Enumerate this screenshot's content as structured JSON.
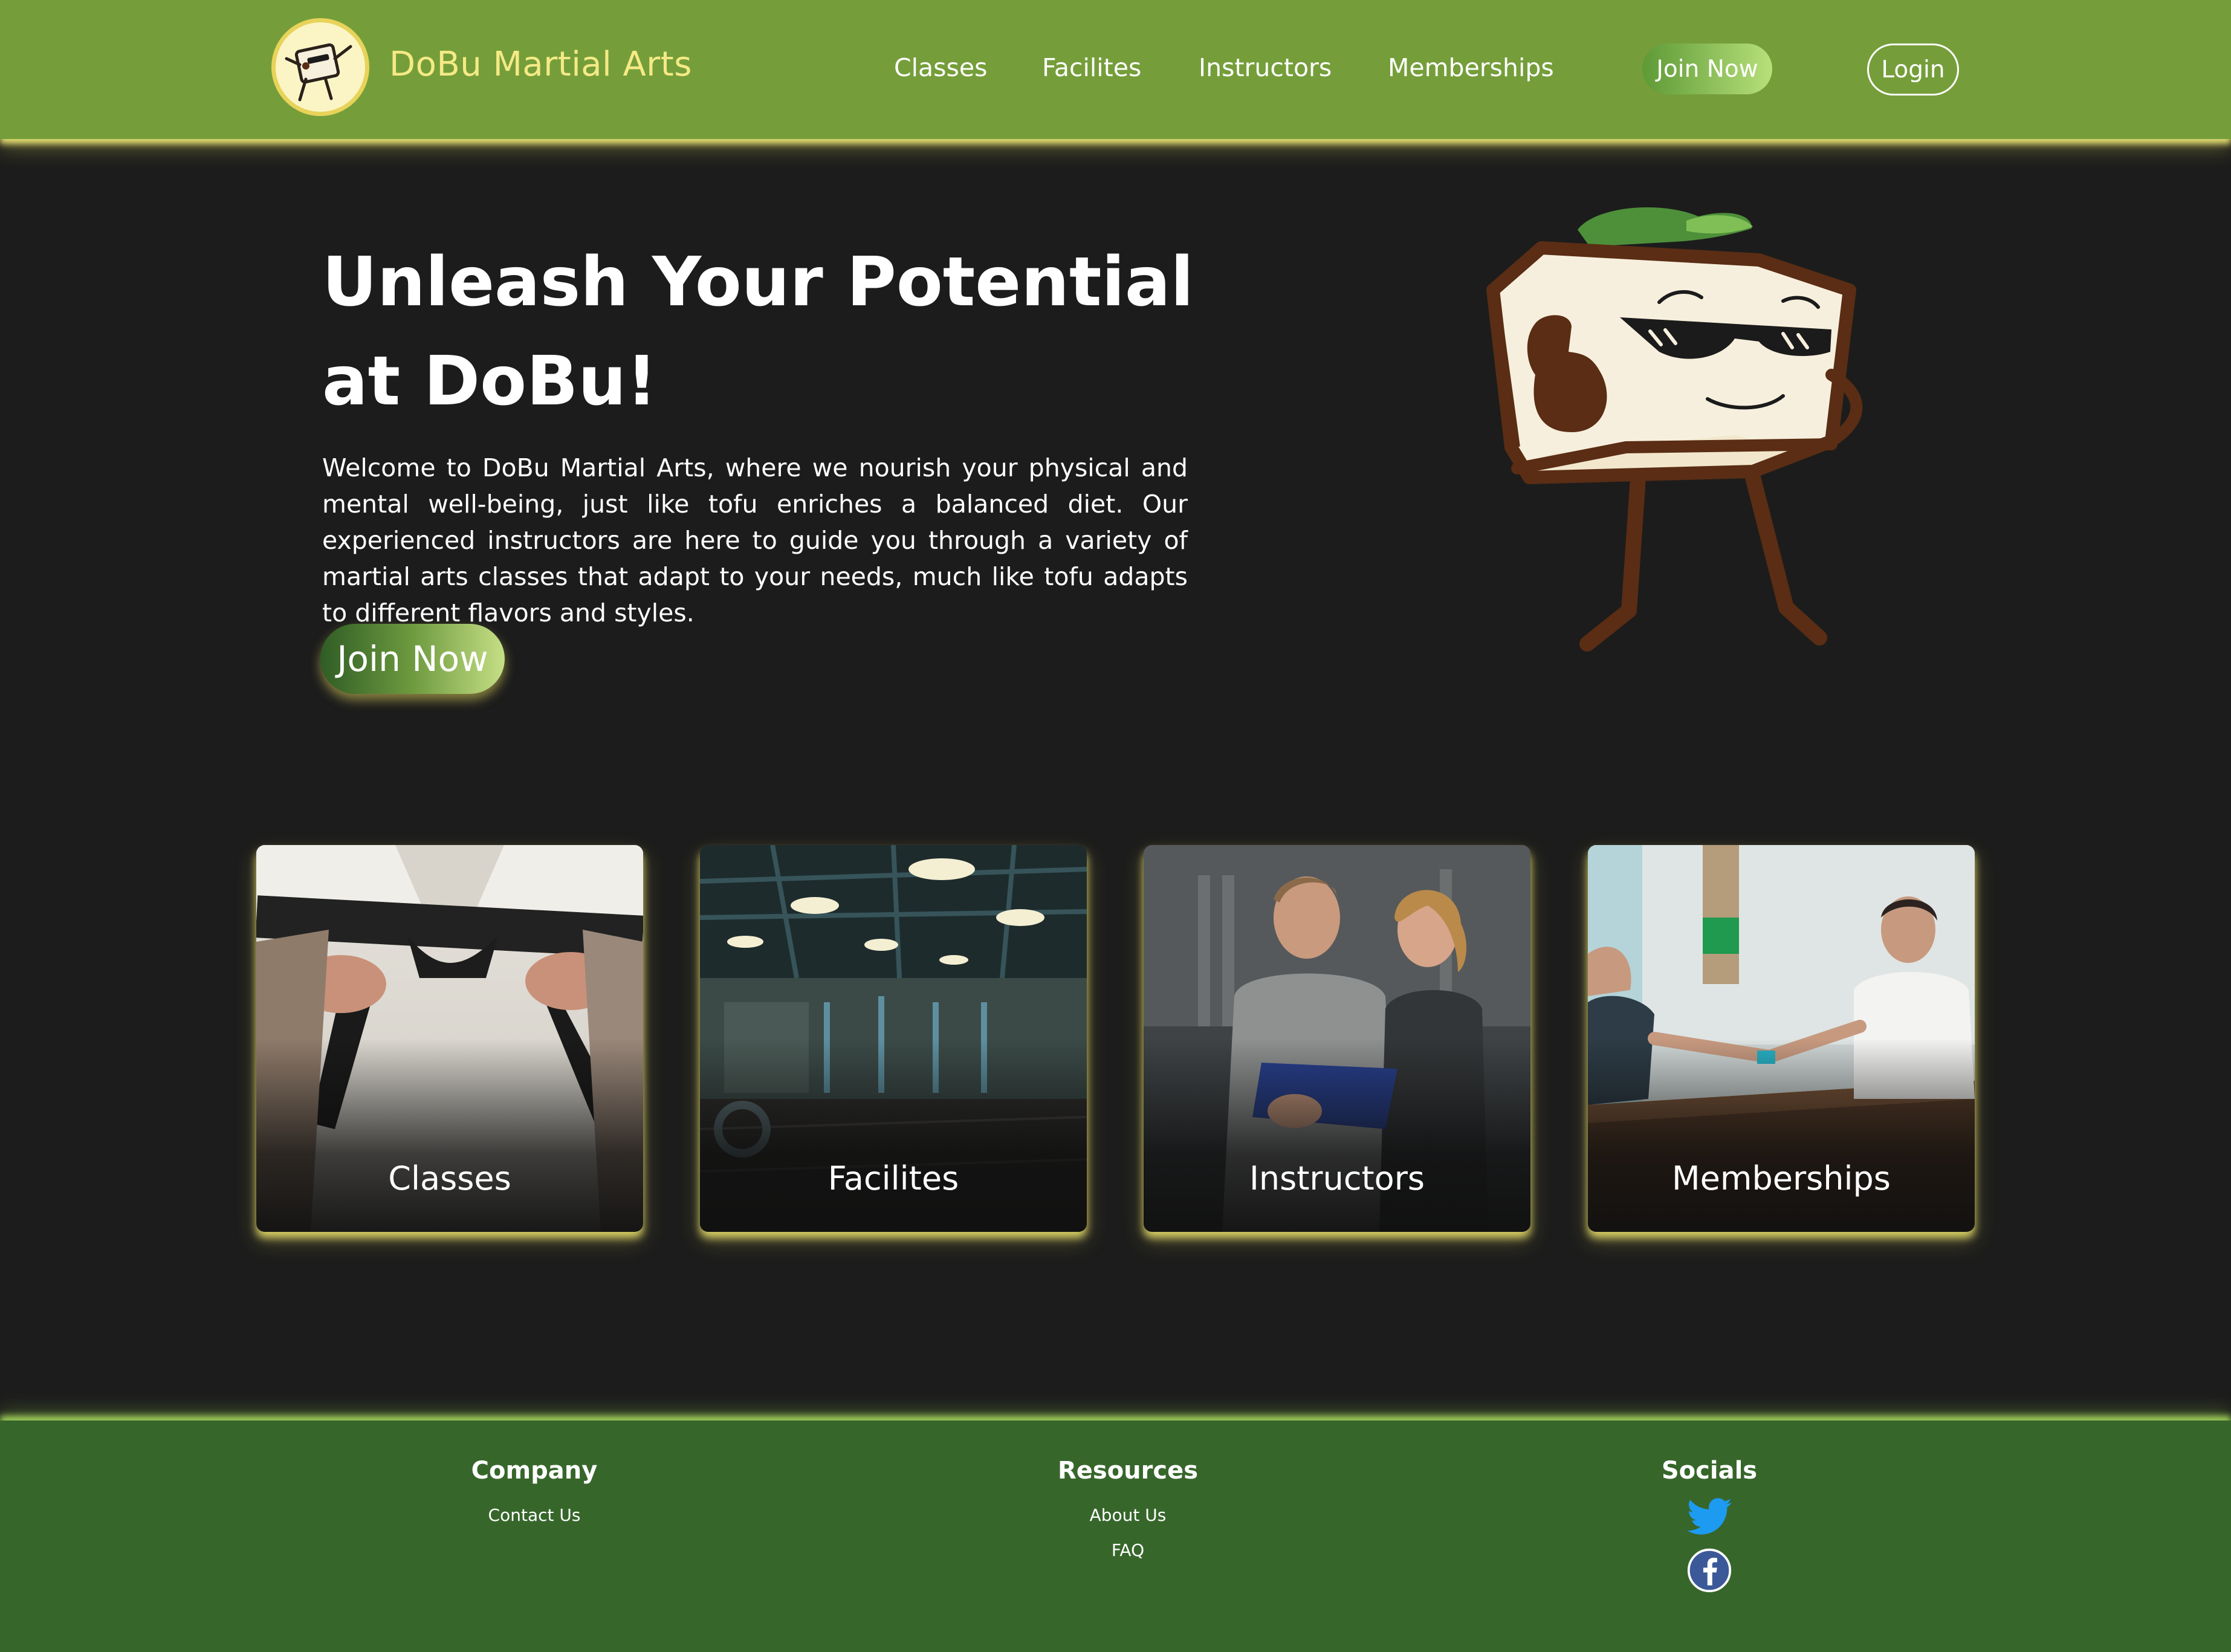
{
  "header": {
    "brand": "DoBu Martial Arts",
    "nav": [
      "Classes",
      "Facilites",
      "Instructors",
      "Memberships"
    ],
    "join_label": "Join Now",
    "login_label": "Login"
  },
  "hero": {
    "title": "Unleash Your Potential at DoBu!",
    "text": "Welcome to DoBu Martial Arts, where we nourish your physical and mental well-being, just like tofu enriches a balanced diet. Our experienced instructors are here to guide you through a variety of martial arts classes that adapt to your needs, much like tofu adapts to different flavors and styles.",
    "cta_label": "Join Now",
    "image": "tofu-mascot-with-sunglasses"
  },
  "cards": [
    {
      "label": "Classes",
      "image": "karate-black-belt-photo"
    },
    {
      "label": "Facilites",
      "image": "gym-interior-photo"
    },
    {
      "label": "Instructors",
      "image": "trainers-with-clipboard-photo"
    },
    {
      "label": "Memberships",
      "image": "reception-desk-photo"
    }
  ],
  "footer": {
    "company": {
      "heading": "Company",
      "links": [
        "Contact Us"
      ]
    },
    "resources": {
      "heading": "Resources",
      "links": [
        "About Us",
        "FAQ"
      ]
    },
    "socials": {
      "heading": "Socials",
      "icons": [
        "twitter-icon",
        "facebook-icon"
      ]
    }
  },
  "colors": {
    "header_bg": "#759e3a",
    "brand_text": "#f5ea86",
    "page_bg": "#1c1c1c",
    "footer_bg": "#37662b",
    "glow": "#e8df6e"
  }
}
